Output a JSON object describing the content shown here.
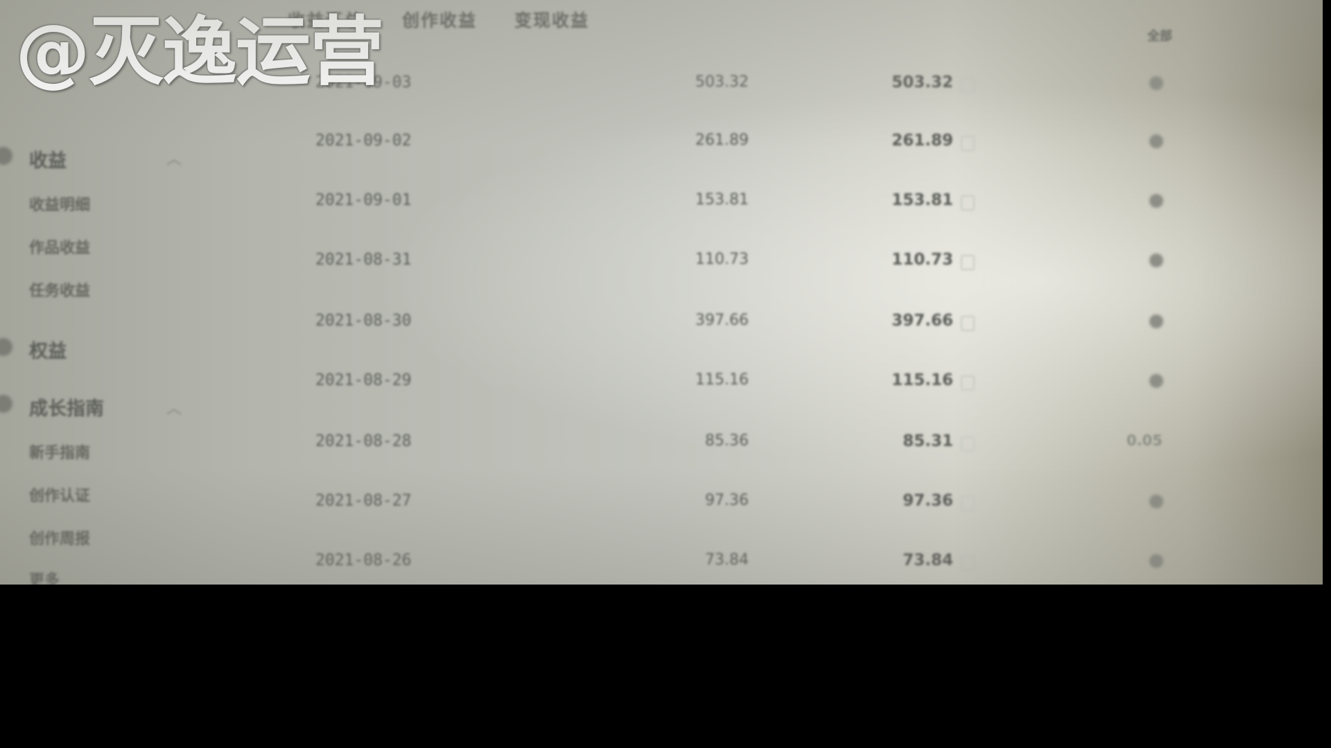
{
  "watermark": "@灭逸运营",
  "tabs": [
    "收益汇总",
    "创作收益",
    "变现收益"
  ],
  "top_right_text": "全部",
  "sidebar": {
    "groups": [
      {
        "label": "收益",
        "items": [
          "收益明细",
          "作品收益",
          "任务收益"
        ]
      },
      {
        "label": "权益",
        "items": []
      },
      {
        "label": "成长指南",
        "items": [
          "新手指南",
          "创作认证",
          "创作周报",
          "更多"
        ]
      }
    ]
  },
  "table": {
    "rows": [
      {
        "date": "2021-09-03",
        "income": "503.32",
        "total": "503.32",
        "extra": ""
      },
      {
        "date": "2021-09-02",
        "income": "261.89",
        "total": "261.89",
        "extra": ""
      },
      {
        "date": "2021-09-01",
        "income": "153.81",
        "total": "153.81",
        "extra": ""
      },
      {
        "date": "2021-08-31",
        "income": "110.73",
        "total": "110.73",
        "extra": ""
      },
      {
        "date": "2021-08-30",
        "income": "397.66",
        "total": "397.66",
        "extra": ""
      },
      {
        "date": "2021-08-29",
        "income": "115.16",
        "total": "115.16",
        "extra": ""
      },
      {
        "date": "2021-08-28",
        "income": "85.36",
        "total": "85.31",
        "extra": "0.05"
      },
      {
        "date": "2021-08-27",
        "income": "97.36",
        "total": "97.36",
        "extra": ""
      },
      {
        "date": "2021-08-26",
        "income": "73.84",
        "total": "73.84",
        "extra": ""
      }
    ]
  }
}
